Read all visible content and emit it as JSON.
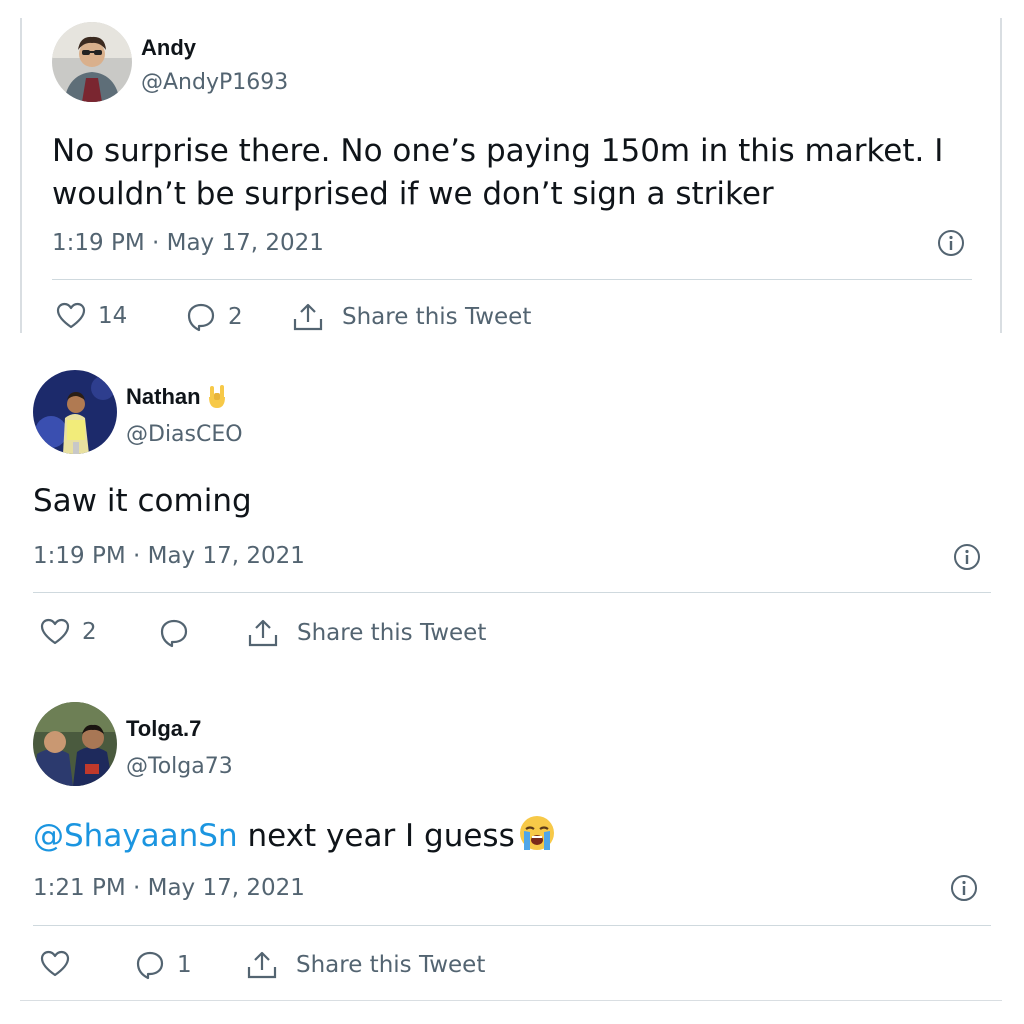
{
  "tweets": [
    {
      "author_name": "Andy",
      "author_handle": "@AndyP1693",
      "body_line1": "No surprise there. No one’s paying 150m in this market. I",
      "body_line2": "wouldn’t be surprised if we don’t sign a striker",
      "timestamp": "1:19 PM · May 17, 2021",
      "like_count": "14",
      "reply_count": "2",
      "share_label": "Share this Tweet"
    },
    {
      "author_name": "Nathan",
      "author_name_emoji": "rock-on-hand-emoji",
      "author_handle": "@DiasCEO",
      "body": "Saw it coming",
      "timestamp": "1:19 PM · May 17, 2021",
      "like_count": "2",
      "reply_count": "",
      "share_label": "Share this Tweet"
    },
    {
      "author_name": "Tolga.7",
      "author_handle": "@Tolga73",
      "mention": "@ShayaanSn",
      "body": " next year I guess",
      "body_emoji": "loudly-crying-face-emoji",
      "timestamp": "1:21 PM · May 17, 2021",
      "like_count": "",
      "reply_count": "1",
      "share_label": "Share this Tweet"
    }
  ],
  "colors": {
    "text": "#0f1419",
    "secondary": "#536471",
    "mention": "#1b95e0",
    "divider": "#cfd9de"
  },
  "icons": [
    "heart-icon",
    "reply-icon",
    "share-icon",
    "info-icon"
  ]
}
